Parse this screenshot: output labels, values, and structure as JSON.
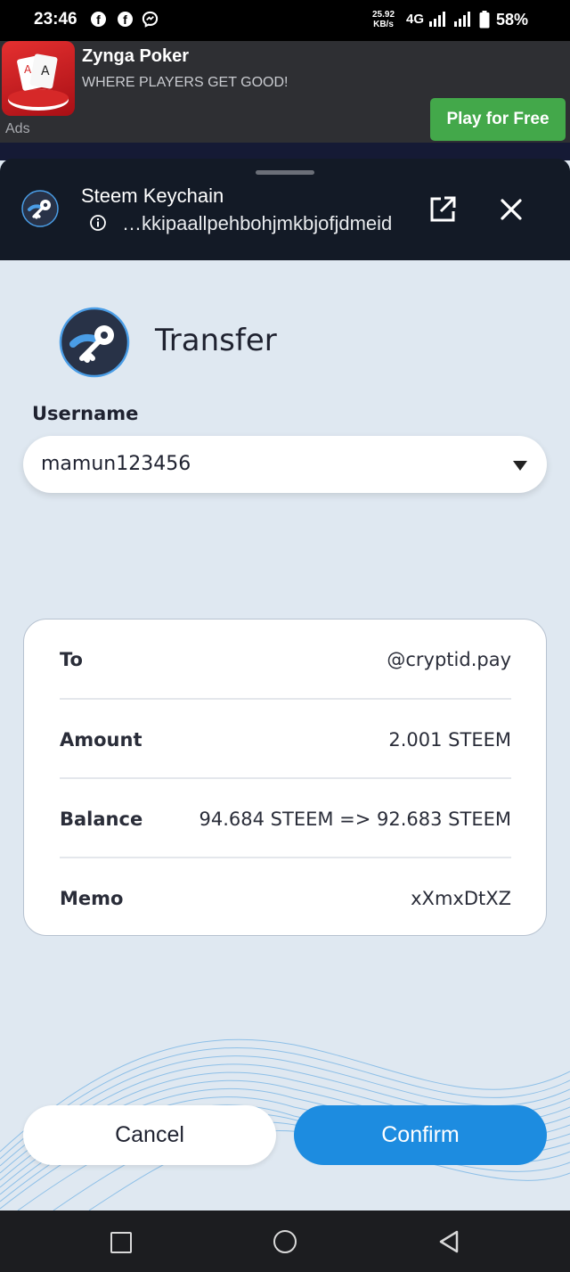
{
  "status_bar": {
    "time": "23:46",
    "net_speed_value": "25.92",
    "net_speed_unit": "KB/s",
    "network": "4G",
    "battery": "58%",
    "notif_icons": [
      "facebook-icon",
      "facebook-icon",
      "messenger-icon"
    ]
  },
  "ad": {
    "app_name": "Zynga Poker",
    "tagline": "WHERE PLAYERS GET GOOD!",
    "label": "Ads",
    "cta": "Play for Free"
  },
  "sheet": {
    "app_name": "Steem Keychain",
    "url": "…kkipaallpehbohjmkbjofjdmeid"
  },
  "transfer": {
    "title": "Transfer",
    "username_label": "Username",
    "username_value": "mamun123456",
    "rows": [
      {
        "label": "To",
        "value": "@cryptid.pay"
      },
      {
        "label": "Amount",
        "value": "2.001 STEEM"
      },
      {
        "label": "Balance",
        "value": "94.684 STEEM => 92.683 STEEM"
      },
      {
        "label": "Memo",
        "value": "xXmxDtXZ"
      }
    ],
    "cancel_label": "Cancel",
    "confirm_label": "Confirm"
  },
  "colors": {
    "accent": "#1d8ce0",
    "background": "#dfe8f1",
    "header": "#131a26",
    "ad_button": "#43a84a"
  }
}
